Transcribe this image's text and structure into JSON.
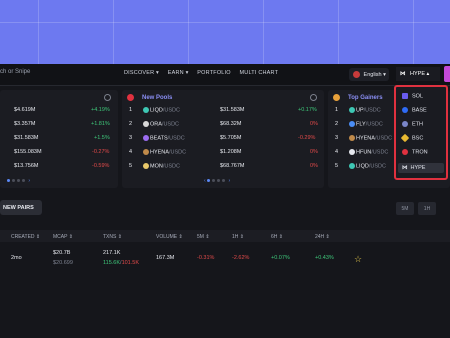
{
  "topbar": {
    "search_text": "ch or Snipe",
    "nav": [
      "DISCOVER ▾",
      "EARN ▾",
      "PORTFOLIO",
      "MULTI CHART"
    ],
    "language": "English ▾",
    "chain": "HYPE ▴"
  },
  "panel_left": {
    "rows": [
      {
        "mcap": "$4.619M",
        "change": "+4.19%"
      },
      {
        "mcap": "$3.357M",
        "change": "+1.81%"
      },
      {
        "mcap": "$31.583M",
        "change": "+1.5%"
      },
      {
        "mcap": "$155.083M",
        "change": "-0.27%"
      },
      {
        "mcap": "$13.756M",
        "change": "-0.59%"
      }
    ]
  },
  "panel_new_pools": {
    "title": "New Pools",
    "rows": [
      {
        "rank": "1",
        "pair": "LIQD",
        "quote": "/USDC",
        "mcap": "$31.583M",
        "change": "+0.17%"
      },
      {
        "rank": "2",
        "pair": "ORA",
        "quote": "/USDC",
        "mcap": "$68.32M",
        "change": "0%"
      },
      {
        "rank": "3",
        "pair": "BEATS",
        "quote": "/USDC",
        "mcap": "$5.705M",
        "change": "-0.29%"
      },
      {
        "rank": "4",
        "pair": "HYENA",
        "quote": "/USDC",
        "mcap": "$1.208M",
        "change": "0%"
      },
      {
        "rank": "5",
        "pair": "MON",
        "quote": "/USDC",
        "mcap": "$68.767M",
        "change": "0%"
      }
    ]
  },
  "panel_top_gainers": {
    "title": "Top Gainers",
    "rows": [
      {
        "rank": "1",
        "pair": "UP",
        "quote": "/USDC"
      },
      {
        "rank": "2",
        "pair": "FLY",
        "quote": "/USDC"
      },
      {
        "rank": "3",
        "pair": "HYENA",
        "quote": "/USDC"
      },
      {
        "rank": "4",
        "pair": "HFUN",
        "quote": "/USDC"
      },
      {
        "rank": "5",
        "pair": "LIQD",
        "quote": "/USDC"
      }
    ]
  },
  "pager": {
    "prev": "‹",
    "next": "›"
  },
  "new_pairs_label": "NEW PAIRS",
  "timeframes": [
    "5M",
    "1H"
  ],
  "table": {
    "headers": [
      "CREATED ⇕",
      "MCAP ⇕",
      "TXNS ⇕",
      "VOLUME ⇕",
      "5M ⇕",
      "1H ⇕",
      "6H ⇕",
      "24H ⇕"
    ],
    "row": {
      "created": "2mo",
      "mcap": "$20.7B",
      "mcap_sub": "$20.699",
      "txns": "217.1K",
      "txns_buys": "115.6K",
      "txns_sells": "101.5K",
      "volume": "167.3M",
      "m5": "-0.31%",
      "h1": "-2.62%",
      "h6": "+0.07%",
      "h24": "+0.43%"
    }
  },
  "chain_dropdown": {
    "items": [
      {
        "label": "SOL",
        "icon": "solana-icon",
        "color": "#6a5cf0"
      },
      {
        "label": "BASE",
        "icon": "base-icon",
        "color": "#2f6bf5"
      },
      {
        "label": "ETH",
        "icon": "ethereum-icon",
        "color": "#7a86c9"
      },
      {
        "label": "BSC",
        "icon": "bnb-icon",
        "color": "#e8b931"
      },
      {
        "label": "TRON",
        "icon": "tron-icon",
        "color": "#e0313f"
      },
      {
        "label": "HYPE",
        "icon": "hyperliquid-icon",
        "color": "#dfe2ea"
      }
    ],
    "highlight_color": "#e0313f"
  },
  "colors": {
    "background": "#6d79f0",
    "app": "#15161b",
    "positive": "#3ec77a",
    "negative": "#e24a4a",
    "accent": "#8b8ff5"
  }
}
